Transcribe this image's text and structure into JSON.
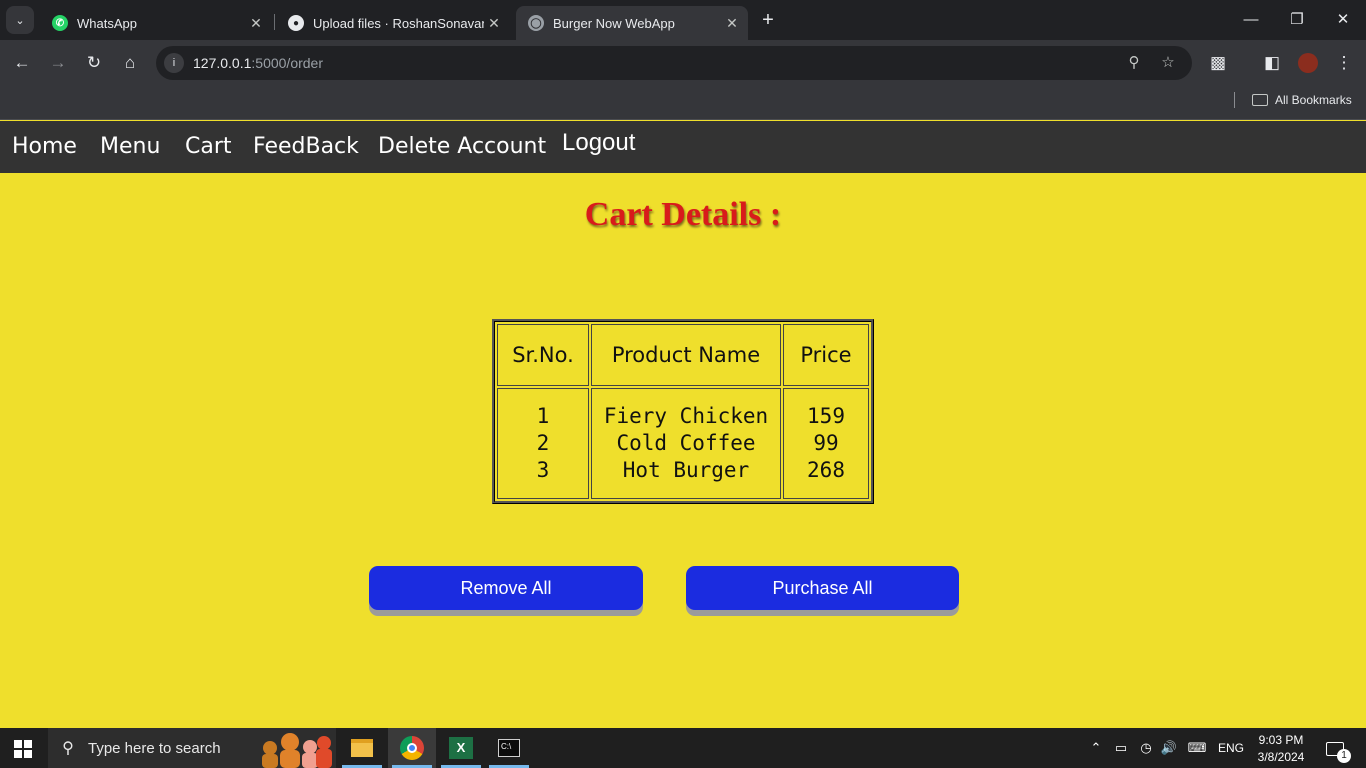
{
  "browser": {
    "tabs": [
      {
        "title": "WhatsApp",
        "icon": "whatsapp-icon"
      },
      {
        "title": "Upload files · RoshanSonavane/",
        "icon": "github-icon"
      },
      {
        "title": "Burger Now WebApp",
        "icon": "globe-icon"
      }
    ],
    "active_tab": 2,
    "url_host": "127.0.0.1",
    "url_rest": ":5000/order",
    "bookmarks_label": "All Bookmarks"
  },
  "nav": {
    "home": "Home",
    "menu": "Menu",
    "cart": "Cart",
    "feedback": "FeedBack",
    "delete_account": "Delete Account",
    "logout": "Logout"
  },
  "page": {
    "title": "Cart Details :",
    "title_color": "#d81b1b",
    "background": "#efdf2c"
  },
  "table": {
    "headers": [
      "Sr.No.",
      "Product Name",
      "Price"
    ],
    "rows": [
      {
        "sr": "1",
        "product": "Fiery Chicken",
        "price": "159"
      },
      {
        "sr": "2",
        "product": "Cold Coffee",
        "price": "99"
      },
      {
        "sr": "3",
        "product": "Hot Burger",
        "price": "268"
      }
    ]
  },
  "actions": {
    "remove_all": "Remove All",
    "purchase_all": "Purchase All",
    "button_color": "#1b2ce0"
  },
  "taskbar": {
    "search_placeholder": "Type here to search",
    "language": "ENG",
    "time": "9:03 PM",
    "date": "3/8/2024",
    "notification_count": "1"
  }
}
